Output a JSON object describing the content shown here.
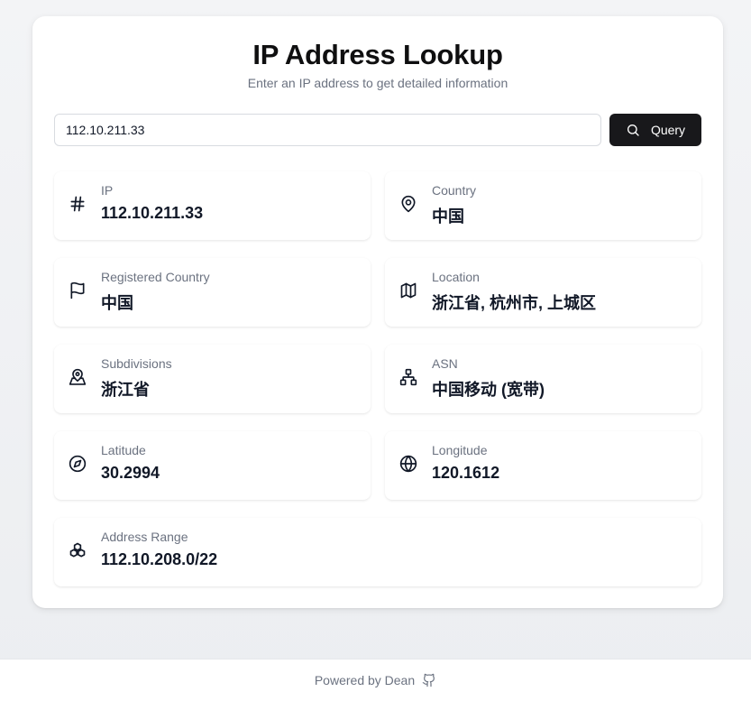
{
  "header": {
    "title": "IP Address Lookup",
    "subtitle": "Enter an IP address to get detailed information"
  },
  "search": {
    "value": "112.10.211.33",
    "button_label": "Query",
    "button_icon": "search-icon"
  },
  "results": [
    {
      "label": "IP",
      "value": "112.10.211.33",
      "icon": "hash-icon"
    },
    {
      "label": "Country",
      "value": "中国",
      "icon": "map-pin-icon"
    },
    {
      "label": "Registered Country",
      "value": "中国",
      "icon": "flag-icon"
    },
    {
      "label": "Location",
      "value": "浙江省, 杭州市, 上城区",
      "icon": "map-icon"
    },
    {
      "label": "Subdivisions",
      "value": "浙江省",
      "icon": "map-pin-user-icon"
    },
    {
      "label": "ASN",
      "value": "中国移动 (宽带)",
      "icon": "network-icon"
    },
    {
      "label": "Latitude",
      "value": "30.2994",
      "icon": "compass-icon"
    },
    {
      "label": "Longitude",
      "value": "120.1612",
      "icon": "globe-icon"
    },
    {
      "label": "Address Range",
      "value": "112.10.208.0/22",
      "icon": "boxes-icon"
    }
  ],
  "footer": {
    "text": "Powered by Dean",
    "icon": "github-icon"
  },
  "colors": {
    "button_bg": "#18181b",
    "muted_text": "#6b7280",
    "primary_text": "#111827"
  }
}
